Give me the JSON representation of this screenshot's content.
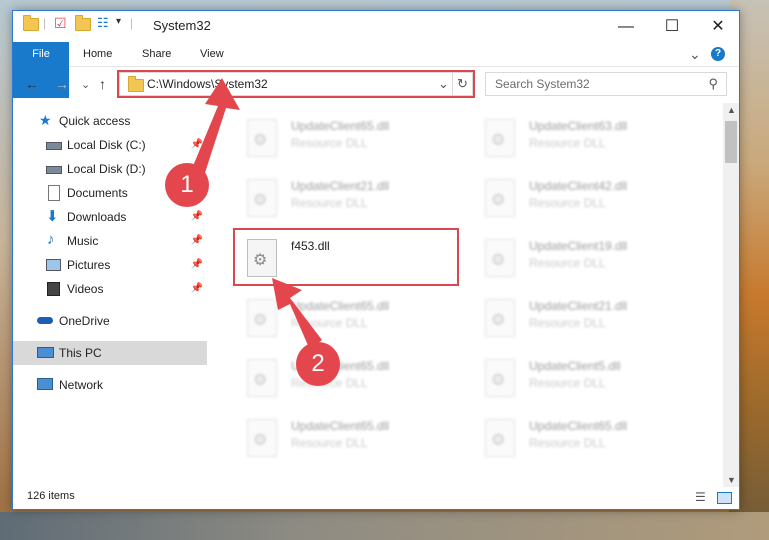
{
  "window": {
    "title": "System32",
    "controls": {
      "minimize": "—",
      "maximize": "☐",
      "close": "✕"
    }
  },
  "ribbon": {
    "tabs": [
      {
        "label": "File"
      },
      {
        "label": "Home"
      },
      {
        "label": "Share"
      },
      {
        "label": "View"
      }
    ],
    "expand_glyph": "⌄",
    "help_glyph": "?"
  },
  "navigation": {
    "back_glyph": "←",
    "forward_glyph": "→",
    "recent_glyph": "⌄",
    "up_glyph": "↑",
    "address": "C:\\Windows\\System32",
    "dropdown_glyph": "⌄",
    "refresh_glyph": "↻",
    "search_placeholder": "Search System32",
    "search_glyph": "⚲"
  },
  "sidebar": {
    "items": [
      {
        "label": "Quick access",
        "icon": "star-icon",
        "pinned": false
      },
      {
        "label": "Local Disk (C:)",
        "icon": "drive-icon",
        "pinned": true
      },
      {
        "label": "Local Disk (D:)",
        "icon": "drive-icon",
        "pinned": true
      },
      {
        "label": "Documents",
        "icon": "documents-icon",
        "pinned": true
      },
      {
        "label": "Downloads",
        "icon": "downloads-icon",
        "pinned": true
      },
      {
        "label": "Music",
        "icon": "music-icon",
        "pinned": true
      },
      {
        "label": "Pictures",
        "icon": "pictures-icon",
        "pinned": true
      },
      {
        "label": "Videos",
        "icon": "videos-icon",
        "pinned": true
      },
      {
        "label": "OneDrive",
        "icon": "cloud-icon",
        "pinned": false
      },
      {
        "label": "This PC",
        "icon": "computer-icon",
        "pinned": false,
        "selected": true
      },
      {
        "label": "Network",
        "icon": "network-icon",
        "pinned": false
      }
    ]
  },
  "files": {
    "items": [
      {
        "name": "UpdateClient65.dll",
        "type": "Resource DLL"
      },
      {
        "name": "UpdateClient63.dll",
        "type": "Resource DLL"
      },
      {
        "name": "UpdateClient21.dll",
        "type": "Resource DLL"
      },
      {
        "name": "UpdateClient42.dll",
        "type": "Resource DLL"
      },
      {
        "name": "f453.dll",
        "type": ""
      },
      {
        "name": "UpdateClient19.dll",
        "type": "Resource DLL"
      },
      {
        "name": "UpdateClient65.dll",
        "type": "Resource DLL"
      },
      {
        "name": "UpdateClient21.dll",
        "type": "Resource DLL"
      },
      {
        "name": "UpdateClient65.dll",
        "type": "Resource DLL"
      },
      {
        "name": "UpdateClient5.dll",
        "type": "Resource DLL"
      },
      {
        "name": "UpdateClient65.dll",
        "type": "Resource DLL"
      },
      {
        "name": "UpdateClient65.dll",
        "type": "Resource DLL"
      }
    ]
  },
  "status": {
    "item_count": "126 items"
  },
  "annotations": {
    "step1": "1",
    "step2": "2"
  },
  "colors": {
    "accent": "#1979ca",
    "highlight": "#d9484e",
    "badge": "#e3474d"
  }
}
